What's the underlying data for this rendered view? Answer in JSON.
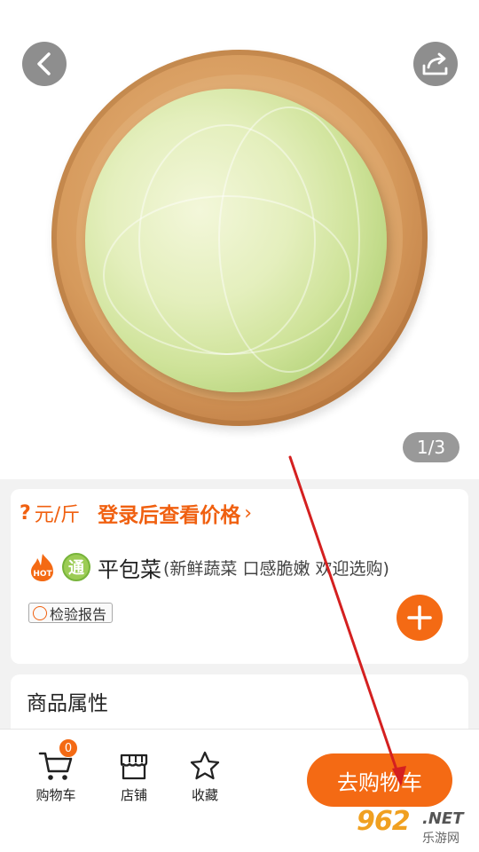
{
  "gallery": {
    "pager_text": "1/3",
    "image_subject": "cabbage-on-wooden-plate"
  },
  "nav": {
    "back_icon": "chevron-left-icon",
    "share_icon": "share-icon"
  },
  "product": {
    "price_symbol": "?",
    "price_unit": "元/斤",
    "login_price_text": "登录后查看价格",
    "login_arrow": "›",
    "hot_badge_text": "HOT",
    "tong_badge_text": "通",
    "name": "平包菜",
    "description": "(新鲜蔬菜 口感脆嫩 欢迎选购)",
    "report_tag": "检验报告"
  },
  "attributes": {
    "title": "商品属性"
  },
  "bottom_bar": {
    "cart_label": "购物车",
    "cart_count": "0",
    "shop_label": "店铺",
    "favorite_label": "收藏",
    "go_cart_label": "去购物车"
  },
  "watermark": {
    "number": "962",
    "domain": ".NET",
    "site_name": "乐游网"
  },
  "colors": {
    "accent": "#f46a14",
    "price": "#f06010",
    "tong_badge": "#9ccc55"
  }
}
